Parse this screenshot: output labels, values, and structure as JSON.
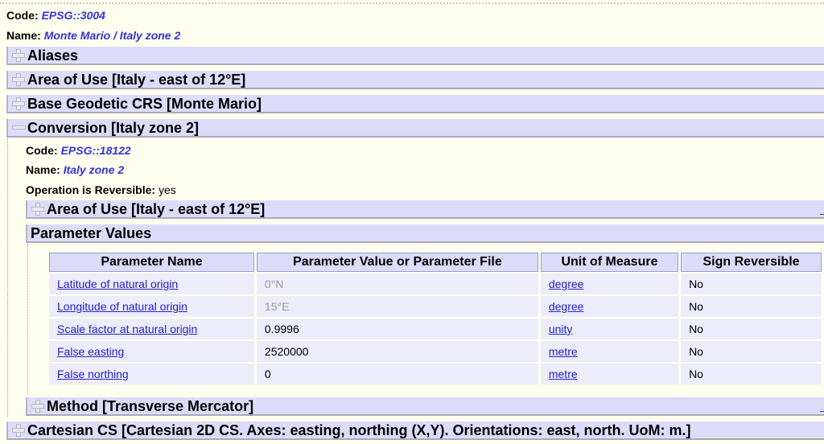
{
  "crs": {
    "code_label": "Code:",
    "code": "EPSG::3004",
    "name_label": "Name:",
    "name": "Monte Mario / Italy zone 2"
  },
  "sections": {
    "aliases": "Aliases",
    "area_of_use": "Area of Use [Italy - east of 12°E]",
    "base_crs": "Base Geodetic CRS [Monte Mario]",
    "conversion": "Conversion [Italy zone 2]",
    "cartesian_cs": "Cartesian CS [Cartesian 2D CS. Axes: easting, northing (X,Y). Orientations: east, north. UoM: m.]"
  },
  "conversion": {
    "code_label": "Code:",
    "code": "EPSG::18122",
    "name_label": "Name:",
    "name": "Italy zone 2",
    "reversible_label": "Operation is Reversible:",
    "reversible": "yes",
    "area_of_use": "Area of Use [Italy - east of 12°E]",
    "parameter_values_title": "Parameter Values",
    "method": "Method [Transverse Mercator]"
  },
  "parameters": {
    "headers": [
      "Parameter Name",
      "Parameter Value or Parameter File",
      "Unit of Measure",
      "Sign Reversible"
    ],
    "rows": [
      {
        "name": "Latitude of natural origin",
        "value": "0°N",
        "unit": "degree",
        "sign_reversible": "No"
      },
      {
        "name": "Longitude of natural origin",
        "value": "15°E",
        "unit": "degree",
        "sign_reversible": "No"
      },
      {
        "name": "Scale factor at natural origin",
        "value": "0.9996",
        "unit": "unity",
        "sign_reversible": "No"
      },
      {
        "name": "False easting",
        "value": "2520000",
        "unit": "metre",
        "sign_reversible": "No"
      },
      {
        "name": "False northing",
        "value": "0",
        "unit": "metre",
        "sign_reversible": "No"
      }
    ]
  },
  "colors": {
    "background": "#fffff0",
    "bar": "#dcdcfa",
    "link": "#3333dd"
  }
}
